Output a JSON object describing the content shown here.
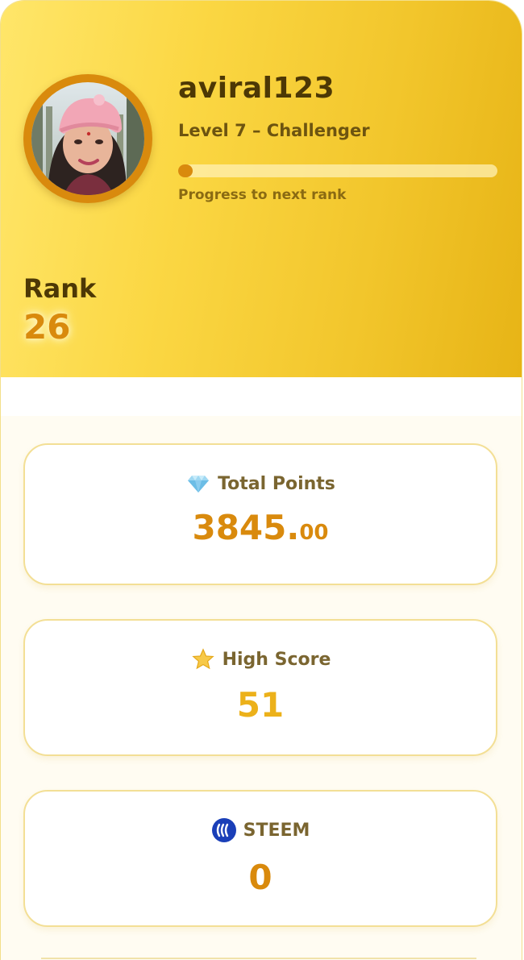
{
  "profile": {
    "username": "aviral123",
    "level_text": "Level 7 – Challenger",
    "progress_caption": "Progress to next rank",
    "progress_fraction": 0.02,
    "avatar_icon": "user-photo"
  },
  "rank": {
    "label": "Rank",
    "value": "26"
  },
  "stats": [
    {
      "label": "Total Points",
      "icon": "gem-icon",
      "value_main": "3845.",
      "value_cents": "00",
      "color": "#d98a0d"
    },
    {
      "label": "High Score",
      "icon": "star-icon",
      "value": "51",
      "color": "#ecb11a"
    },
    {
      "label": "STEEM",
      "icon": "steem-icon",
      "value": "0",
      "color": "#d98a0d"
    }
  ],
  "colors": {
    "accent": "#d98a0d",
    "hero_gradient_start": "#ffe66a",
    "hero_gradient_end": "#e7b416",
    "dark_text": "#4d3805",
    "card_border": "#f3df95"
  }
}
